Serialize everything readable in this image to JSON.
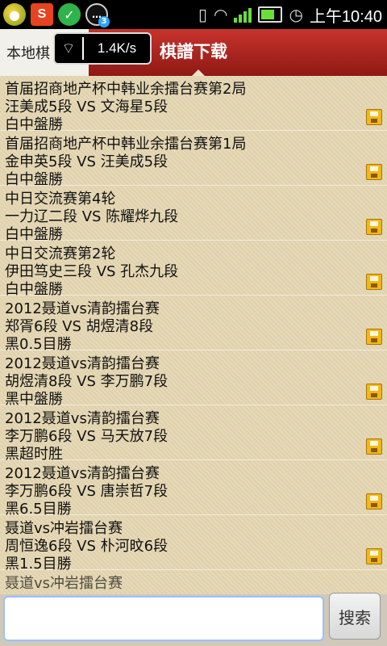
{
  "status_bar": {
    "icons_left": [
      "apps-icon",
      "s-app-icon",
      "check-icon",
      "chat-icon"
    ],
    "s_app_label": "S",
    "check_glyph": "✓",
    "chat_glyph": "…",
    "chat_badge": "3",
    "time": "上午10:40"
  },
  "tabs": {
    "local": "本地棋",
    "download": "棋譜下载"
  },
  "speed": "1.4K/s",
  "games": [
    {
      "title": "首届招商地产杯中韩业余擂台赛第2局",
      "players": "汪美成5段 VS 文海星5段",
      "result": "白中盤勝"
    },
    {
      "title": "首届招商地产杯中韩业余擂台赛第1局",
      "players": "金申英5段 VS 汪美成5段",
      "result": "白中盤勝"
    },
    {
      "title": "中日交流赛第4轮",
      "players": "一力辽二段 VS 陈耀烨九段",
      "result": "白中盤勝"
    },
    {
      "title": "中日交流赛第2轮",
      "players": "伊田笃史三段 VS 孔杰九段",
      "result": "白中盤勝"
    },
    {
      "title": "2012聂道vs清韵擂台赛",
      "players": "郑胥6段 VS 胡煜清8段",
      "result": "黑0.5目勝"
    },
    {
      "title": "2012聂道vs清韵擂台赛",
      "players": "胡煜清8段 VS 李万鹏7段",
      "result": "黑中盤勝"
    },
    {
      "title": "2012聂道vs清韵擂台赛",
      "players": "李万鹏6段 VS 马天放7段",
      "result": "黑超时胜"
    },
    {
      "title": "2012聂道vs清韵擂台赛",
      "players": "李万鹏6段 VS 唐崇哲7段",
      "result": "黑6.5目勝"
    },
    {
      "title": "聂道vs冲岩擂台赛",
      "players": "周恒逸6段 VS 朴河旼6段",
      "result": "黑1.5目勝"
    },
    {
      "title": "聂道vs冲岩擂台赛",
      "players": "",
      "result": ""
    }
  ],
  "search": {
    "value": "",
    "button": "搜索"
  }
}
